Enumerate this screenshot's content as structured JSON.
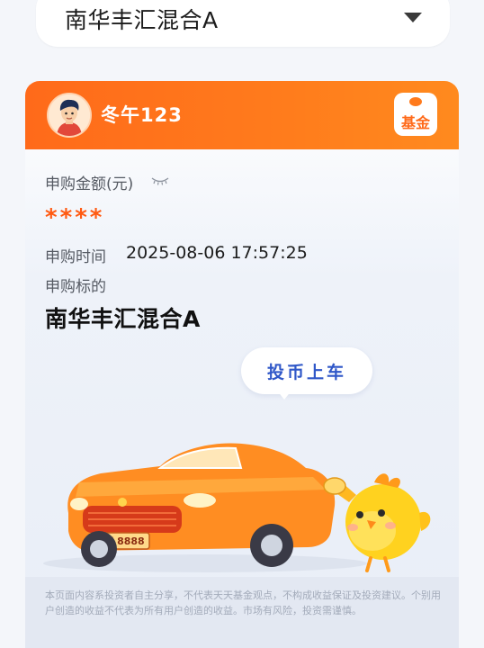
{
  "fund_selector": {
    "selected_fund": "南华丰汇混合A",
    "chevron_icon": "chevron-down-icon"
  },
  "card": {
    "header": {
      "username": "冬午123",
      "avatar_icon": "user-avatar",
      "badge_label": "基金",
      "header_color": "#ff6a1a"
    },
    "purchase_amount": {
      "label": "申购金额(元)",
      "value": "****",
      "visibility_icon": "eye-closed-icon",
      "value_color": "#ff5a12"
    },
    "purchase_time": {
      "label": "申购时间",
      "value": "2025-08-06 17:57:25"
    },
    "purchase_target": {
      "label": "申购标的",
      "value": "南华丰汇混合A"
    },
    "bubble": {
      "text": "投币上车",
      "text_color": "#2f57c8"
    },
    "illustration": {
      "license_plate": "富 8888",
      "car_color": "#ff8a1e",
      "mascot": "yellow-chick"
    },
    "disclaimer": "本页面内容系投资者自主分享，不代表天天基金观点，不构成收益保证及投资建议。个别用户创造的收益不代表为所有用户创造的收益。市场有风险，投资需谨慎。"
  }
}
